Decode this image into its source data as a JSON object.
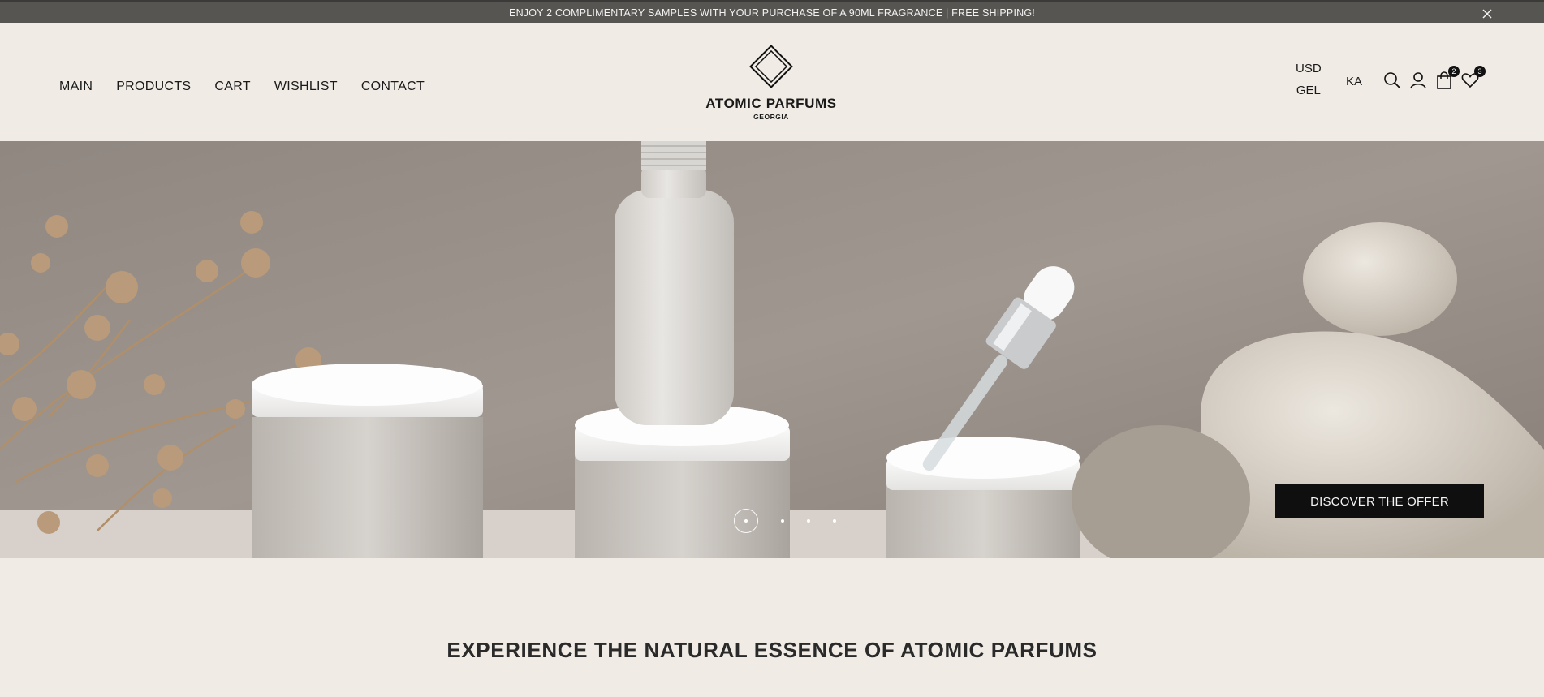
{
  "announcement": {
    "text": "ENJOY 2 COMPLIMENTARY SAMPLES WITH YOUR PURCHASE OF A 90ML FRAGRANCE | FREE SHIPPING!",
    "close_icon": "close-icon"
  },
  "nav": {
    "items": [
      {
        "label": "MAIN"
      },
      {
        "label": "PRODUCTS"
      },
      {
        "label": "CART"
      },
      {
        "label": "WISHLIST"
      },
      {
        "label": "CONTACT"
      }
    ]
  },
  "logo": {
    "name": "ATOMIC PARFUMS",
    "subtitle": "GEORGIA"
  },
  "currency": {
    "options": [
      "USD",
      "GEL"
    ]
  },
  "language": "KA",
  "header_icons": {
    "search": "search-icon",
    "account": "user-icon",
    "cart": {
      "icon": "shopping-bag-icon",
      "count": "2"
    },
    "wishlist": {
      "icon": "heart-icon",
      "count": "3"
    }
  },
  "hero": {
    "cta_label": "DISCOVER THE OFFER",
    "slides": 4,
    "active_slide": 1
  },
  "headline": "EXPERIENCE THE NATURAL ESSENCE OF ATOMIC PARFUMS",
  "colors": {
    "page_bg": "#f0ebe4",
    "announcement_bg": "#575552",
    "cta_bg": "#0f0f0f"
  }
}
